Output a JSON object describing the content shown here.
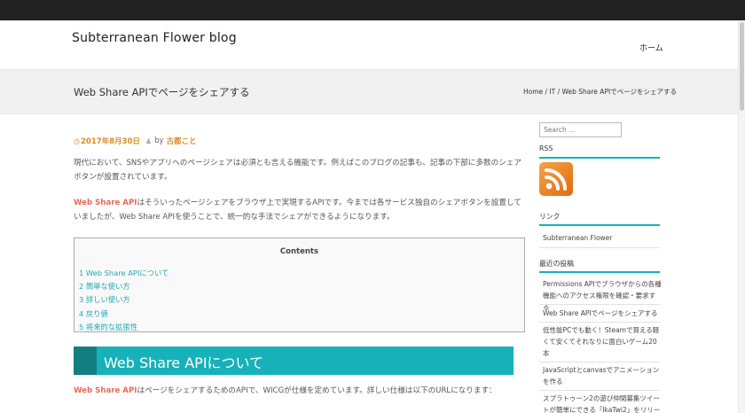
{
  "site": {
    "title": "Subterranean Flower blog",
    "nav_home": "ホーム"
  },
  "page": {
    "title": "Web Share APIでページをシェアする",
    "breadcrumb": [
      "Home",
      "IT",
      "Web Share APIでページをシェアする"
    ],
    "breadcrumb_separator": " / "
  },
  "post": {
    "date": "2017年8月30日",
    "by": "by",
    "author": "古都こと",
    "para1": "現代において、SNSやアプリへのページシェアは必須とも言える機能です。例えばこのブログの記事も、記事の下部に多数のシェアボタンが設置されています。",
    "para2_accent": "Web Share API",
    "para2_rest": "はそういったページシェアをブラウザ上で実現するAPIです。今までは各サービス独自のシェアボタンを設置していましたが、Web Share APIを使うことで、統一的な手法でシェアができるようになります。",
    "toc_title": "Contents",
    "toc_items": [
      "1 Web Share APIについて",
      "2 簡単な使い方",
      "3 詳しい使い方",
      "4 戻り値",
      "5 将来的な拡張性"
    ],
    "section_heading": "Web Share APIについて",
    "para3_accent": "Web Share API",
    "para3_rest": "はページをシェアするためのAPIで、WICGが仕様を定めています。詳しい仕様は以下のURLになります："
  },
  "sidebar": {
    "search_placeholder": "Search ...",
    "rss_title": "RSS",
    "links_title": "リンク",
    "links": [
      "Subterranean Flower"
    ],
    "recent_title": "最近の投稿",
    "recent": [
      "Permissions APIでブラウザからの各種機能へのアクセス権限を確認・要求する",
      "Web Share APIでページをシェアする",
      "低性能PCでも動く！Steamで買える軽くて安くてそれなりに面白いゲーム20本",
      "JavaScriptとcanvasでアニメーションを作る",
      "スプラトゥーン2の遊び仲間募集ツイートが簡単にできる「IkaTwi2」をリリー"
    ]
  },
  "colors": {
    "accent_teal": "#17b1b9",
    "accent_dark_teal": "#147f80",
    "accent_orange": "#d98a2b",
    "accent_red": "#e36c5b"
  }
}
